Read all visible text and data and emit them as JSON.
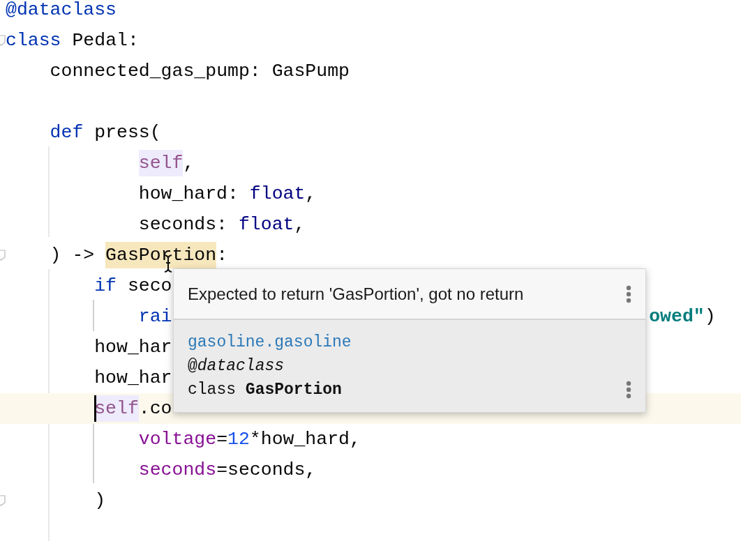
{
  "editor": {
    "lines": [
      {
        "kind": "statement",
        "current": false,
        "fold": false,
        "tokens": [
          {
            "kind": "decorator",
            "text": "@dataclass",
            "highlighted": false
          }
        ]
      },
      {
        "kind": "statement",
        "current": false,
        "fold": true,
        "tokens": [
          {
            "kind": "keyword",
            "text": "class",
            "highlighted": false
          },
          {
            "kind": "plain",
            "text": " Pedal:",
            "highlighted": false
          }
        ],
        "children": [
          {
            "kind": "statement",
            "current": false,
            "fold": false,
            "tokens": [
              {
                "kind": "plain",
                "text": "connected_gas_pump: GasPump",
                "highlighted": false
              }
            ]
          },
          {
            "kind": "statement",
            "current": false,
            "fold": false
          },
          {
            "kind": "statement",
            "current": false,
            "fold": false,
            "tokens": [
              {
                "kind": "keyword",
                "text": "def",
                "highlighted": false
              },
              {
                "kind": "plain",
                "text": " press(",
                "highlighted": false
              }
            ],
            "children": [
              {
                "kind": "continuation",
                "current": false,
                "fold": false,
                "tokens": [
                  {
                    "kind": "self",
                    "text": "self",
                    "highlighted": true
                  },
                  {
                    "kind": "plain",
                    "text": ",",
                    "highlighted": false
                  }
                ]
              },
              {
                "kind": "continuation",
                "current": false,
                "fold": false,
                "tokens": [
                  {
                    "kind": "plain",
                    "text": "how_hard: ",
                    "highlighted": false
                  },
                  {
                    "kind": "builtin",
                    "text": "float",
                    "highlighted": false
                  },
                  {
                    "kind": "plain",
                    "text": ",",
                    "highlighted": false
                  }
                ]
              },
              {
                "kind": "continuation",
                "current": false,
                "fold": false,
                "tokens": [
                  {
                    "kind": "plain",
                    "text": "seconds: ",
                    "highlighted": false
                  },
                  {
                    "kind": "builtin",
                    "text": "float",
                    "highlighted": false
                  },
                  {
                    "kind": "plain",
                    "text": ",",
                    "highlighted": false
                  }
                ]
              }
            ]
          },
          {
            "kind": "statement",
            "current": false,
            "fold": true,
            "tokens": [
              {
                "kind": "plain",
                "text": ") -> ",
                "highlighted": false
              },
              {
                "kind": "plain",
                "text": "GasPortion",
                "highlighted": true
              },
              {
                "kind": "plain",
                "text": ":",
                "highlighted": false
              }
            ],
            "children": [
              {
                "kind": "statement",
                "current": false,
                "fold": false,
                "tokens": [
                  {
                    "kind": "keyword",
                    "text": "if",
                    "highlighted": false
                  },
                  {
                    "kind": "plain",
                    "text": " seco",
                    "highlighted": false
                  }
                ],
                "children": [
                  {
                    "kind": "statement",
                    "current": false,
                    "fold": false,
                    "tokens": [
                      {
                        "kind": "keyword",
                        "text": "rai",
                        "highlighted": false
                      },
                      {
                        "kind": "string",
                        "text": "owed\"",
                        "highlighted": false
                      },
                      {
                        "kind": "plain",
                        "text": ")",
                        "highlighted": false
                      }
                    ]
                  }
                ]
              },
              {
                "kind": "statement",
                "current": false,
                "fold": false,
                "tokens": [
                  {
                    "kind": "plain",
                    "text": "how_har",
                    "highlighted": false
                  }
                ]
              },
              {
                "kind": "statement",
                "current": false,
                "fold": false,
                "tokens": [
                  {
                    "kind": "plain",
                    "text": "how_har",
                    "highlighted": false
                  }
                ]
              },
              {
                "kind": "statement",
                "current": true,
                "fold": false,
                "tokens": [
                  {
                    "kind": "self",
                    "text": "self",
                    "highlighted": true
                  },
                  {
                    "kind": "plain",
                    "text": ".co",
                    "highlighted": false
                  }
                ],
                "children": [
                  {
                    "kind": "statement",
                    "current": false,
                    "fold": false,
                    "tokens": [
                      {
                        "kind": "kwarg",
                        "text": "voltage",
                        "highlighted": false
                      },
                      {
                        "kind": "plain",
                        "text": "=",
                        "highlighted": false
                      },
                      {
                        "kind": "number",
                        "text": "12",
                        "highlighted": false
                      },
                      {
                        "kind": "plain",
                        "text": "*how_hard,",
                        "highlighted": false
                      }
                    ]
                  },
                  {
                    "kind": "statement",
                    "current": false,
                    "fold": false,
                    "tokens": [
                      {
                        "kind": "kwarg",
                        "text": "seconds",
                        "highlighted": false
                      },
                      {
                        "kind": "plain",
                        "text": "=seconds,",
                        "highlighted": false
                      }
                    ]
                  }
                ]
              },
              {
                "kind": "statement",
                "current": false,
                "fold": true,
                "tokens": [
                  {
                    "kind": "plain",
                    "text": ")",
                    "highlighted": false
                  }
                ]
              }
            ]
          }
        ]
      }
    ]
  },
  "popup": {
    "message": "Expected to return 'GasPortion', got no return",
    "module": "gasoline.gasoline",
    "decorator": "@*dataclass*",
    "signature": "class **GasPortion**"
  }
}
